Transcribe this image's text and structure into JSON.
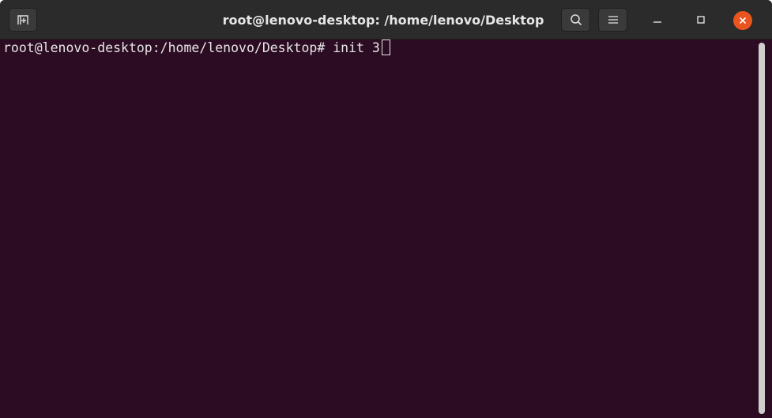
{
  "window": {
    "title": "root@lenovo-desktop: /home/lenovo/Desktop"
  },
  "titlebar": {
    "icons": {
      "new_tab": "new-tab-icon",
      "search": "search-icon",
      "menu": "hamburger-menu-icon",
      "minimize": "minimize-icon",
      "maximize": "maximize-icon",
      "close": "close-icon"
    }
  },
  "terminal": {
    "prompt": "root@lenovo-desktop:/home/lenovo/Desktop# ",
    "command": "init 3"
  },
  "colors": {
    "background": "#2c0c22",
    "titlebar": "#2b2b2b",
    "close_button": "#e9541f",
    "text": "#e6e6e6"
  }
}
